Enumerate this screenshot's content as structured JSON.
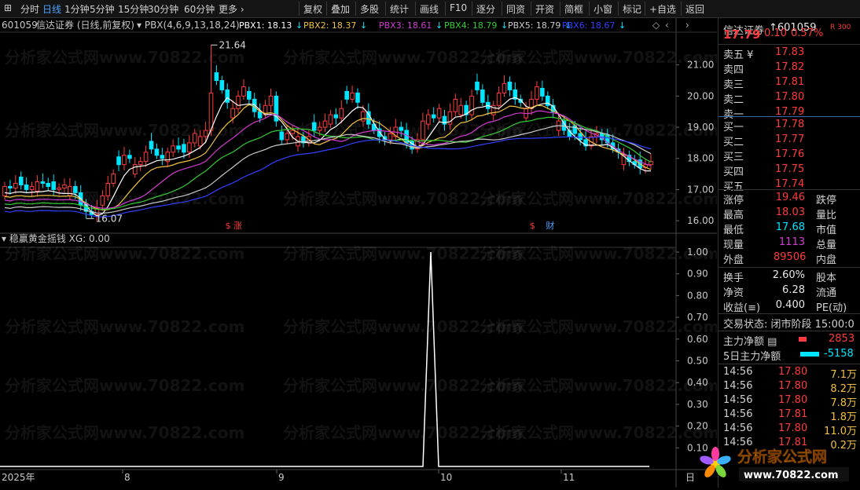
{
  "toolbar": {
    "left": [
      "分时",
      "日线",
      "1分钟",
      "5分钟",
      "15分钟",
      "30分钟",
      "60分钟",
      "更多 ›"
    ],
    "right": [
      "复权",
      "叠加",
      "多股",
      "统计",
      "画线",
      "F10",
      "逐分",
      "同资",
      "开资",
      "简框",
      "小窗",
      "标记",
      "+自选",
      "返回"
    ],
    "active": "日线"
  },
  "chart": {
    "code": "601059",
    "name": "信达证券",
    "mode": "(日线,前复权)",
    "indicator": "PBX(4,6,9,13,18,24)",
    "pbx": [
      {
        "label": "PBX1: 18.13",
        "color": "#ffffff"
      },
      {
        "label": "PBX2: 18.37",
        "color": "#f0c040"
      },
      {
        "label": "PBX3: 18.61",
        "color": "#d23bd2"
      },
      {
        "label": "PBX4: 18.79",
        "color": "#33cc33"
      },
      {
        "label": "PBX5: 18.79",
        "color": "#cccccc"
      },
      {
        "label": "PBX6: 18.67",
        "color": "#3040ff"
      }
    ],
    "high_mark": "21.64",
    "low_mark": "16.07",
    "y_ticks": [
      "21.00",
      "20.00",
      "19.00",
      "18.00",
      "17.00",
      "16.00"
    ],
    "markers": [
      {
        "t": "$",
        "x_day": 55
      },
      {
        "t": "涨",
        "x_day": 57
      },
      {
        "t": "$",
        "x_day": 130
      },
      {
        "t": "财",
        "x_day": 134
      }
    ]
  },
  "sub": {
    "title": "稳赢黄金摇钱",
    "value": "XG: 0.00",
    "y_ticks": [
      "1.00",
      "0.90",
      "0.80",
      "0.70",
      "0.60",
      "0.50",
      "0.40",
      "0.30",
      "0.20",
      "0.10"
    ]
  },
  "x_axis": [
    "2025年",
    "8",
    "9",
    "10",
    "11",
    "日"
  ],
  "chart_data": {
    "type": "candlestick",
    "days": 160,
    "ohlc_note": "approximate daily prices",
    "closes": [
      17.1,
      17.05,
      17.2,
      17.15,
      17.0,
      17.1,
      17.25,
      17.2,
      17.1,
      17.0,
      17.05,
      17.15,
      17.1,
      16.9,
      16.5,
      16.3,
      16.2,
      16.4,
      16.8,
      17.2,
      17.5,
      17.8,
      18.1,
      18.0,
      17.8,
      17.9,
      18.2,
      18.3,
      18.1,
      18.0,
      18.2,
      18.4,
      18.3,
      18.2,
      18.5,
      18.8,
      18.7,
      18.9,
      20.1,
      20.5,
      20.2,
      19.8,
      19.6,
      20.0,
      20.3,
      19.9,
      19.5,
      19.3,
      19.7,
      20.0,
      19.2,
      18.6,
      18.8,
      18.9,
      18.7,
      18.5,
      18.7,
      18.9,
      19.0,
      19.2,
      19.4,
      19.3,
      19.6,
      19.9,
      20.1,
      19.8,
      19.5,
      19.1,
      18.9,
      18.7,
      18.6,
      18.8,
      19.0,
      18.9,
      18.5,
      18.3,
      18.6,
      19.2,
      19.4,
      19.3,
      19.6,
      19.1,
      19.5,
      19.9,
      19.7,
      19.4,
      20.0,
      20.2,
      19.8,
      19.6,
      19.7,
      20.1,
      20.4,
      20.2,
      19.9,
      19.8,
      19.6,
      19.9,
      20.3,
      20.0,
      19.7,
      19.5,
      19.2,
      18.9,
      18.7,
      18.8,
      18.6,
      18.4,
      18.7,
      18.8,
      18.6,
      18.5,
      18.3,
      18.2,
      18.1,
      17.9,
      17.8,
      17.7,
      17.8,
      17.9
    ],
    "xg_values": {
      "spike_day_fraction": 0.66,
      "value": 1.0
    }
  },
  "side": {
    "code": "601059",
    "name": "信达证券",
    "price": "17.79",
    "change": "0.10",
    "pct": "0.57%",
    "asks": [
      {
        "label": "卖五",
        "flag": "¥",
        "price": "17.83"
      },
      {
        "label": "卖四",
        "flag": "",
        "price": "17.82"
      },
      {
        "label": "卖三",
        "flag": "",
        "price": "17.81"
      },
      {
        "label": "卖二",
        "flag": "",
        "price": "17.80"
      },
      {
        "label": "卖一",
        "flag": "",
        "price": "17.79"
      }
    ],
    "bids": [
      {
        "label": "买一",
        "price": "17.78"
      },
      {
        "label": "买二",
        "price": "17.77"
      },
      {
        "label": "买三",
        "price": "17.76"
      },
      {
        "label": "买四",
        "price": "17.75"
      },
      {
        "label": "买五",
        "price": "17.74"
      }
    ],
    "stats": [
      {
        "k": "涨停",
        "v": "19.46",
        "vc": "red",
        "k2": "跌停"
      },
      {
        "k": "最高",
        "v": "18.03",
        "vc": "red",
        "k2": "量比"
      },
      {
        "k": "最低",
        "v": "17.68",
        "vc": "cyan",
        "k2": "市值"
      },
      {
        "k": "现量",
        "v": "1113",
        "vc": "mag",
        "k2": "总量"
      },
      {
        "k": "外盘",
        "v": "89506",
        "vc": "red",
        "k2": "内盘"
      }
    ],
    "stats2": [
      {
        "k": "换手",
        "v": "2.60%",
        "k2": "股本"
      },
      {
        "k": "净资",
        "v": "6.28",
        "k2": "流通"
      },
      {
        "k": "收益(≡)",
        "v": "0.400",
        "k2": "PE(动)"
      }
    ],
    "trade_state": "交易状态: 闭市阶段 15:00:0",
    "main_net": {
      "k": "主力净额",
      "v": "2853"
    },
    "main_net5": {
      "k": "5日主力净额",
      "v": "-5158"
    },
    "ticks": [
      {
        "t": "14:56",
        "p": "17.80",
        "v": "7.1万"
      },
      {
        "t": "14:56",
        "p": "17.80",
        "v": "8.2万"
      },
      {
        "t": "14:56",
        "p": "17.80",
        "v": "7.8万"
      },
      {
        "t": "14:56",
        "p": "17.81",
        "v": "1.8万"
      },
      {
        "t": "14:56",
        "p": "17.80",
        "v": "11.0万"
      },
      {
        "t": "14:56",
        "p": "17.81",
        "v": "0.2万"
      }
    ]
  },
  "watermark": "分析家公式网www.70822.com",
  "logo": {
    "title": "分析家公式网",
    "url": "www.70822.com"
  }
}
